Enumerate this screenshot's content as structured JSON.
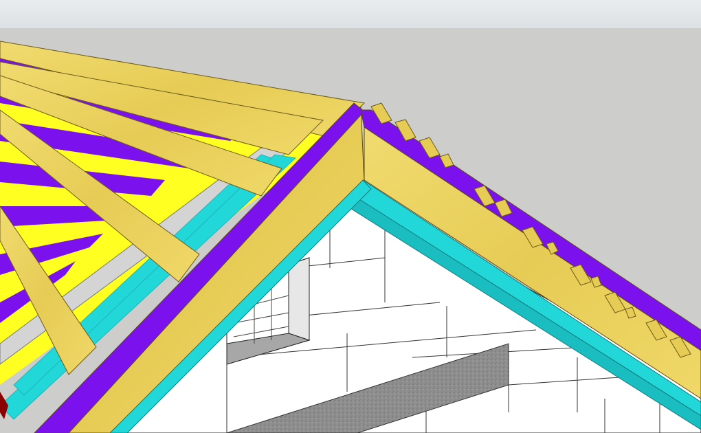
{
  "app": {
    "toolbar": {},
    "viewport": {
      "description_colors": {
        "sky": "#cdcdcb",
        "wall": "#ffffff",
        "rafter": "#ecd45a",
        "fascia": "#7b12ee",
        "insulation": "#ffff22",
        "batten": "#22d7d8",
        "lintel": "#8e8e8e",
        "opening": "#a7a7a7"
      }
    }
  }
}
